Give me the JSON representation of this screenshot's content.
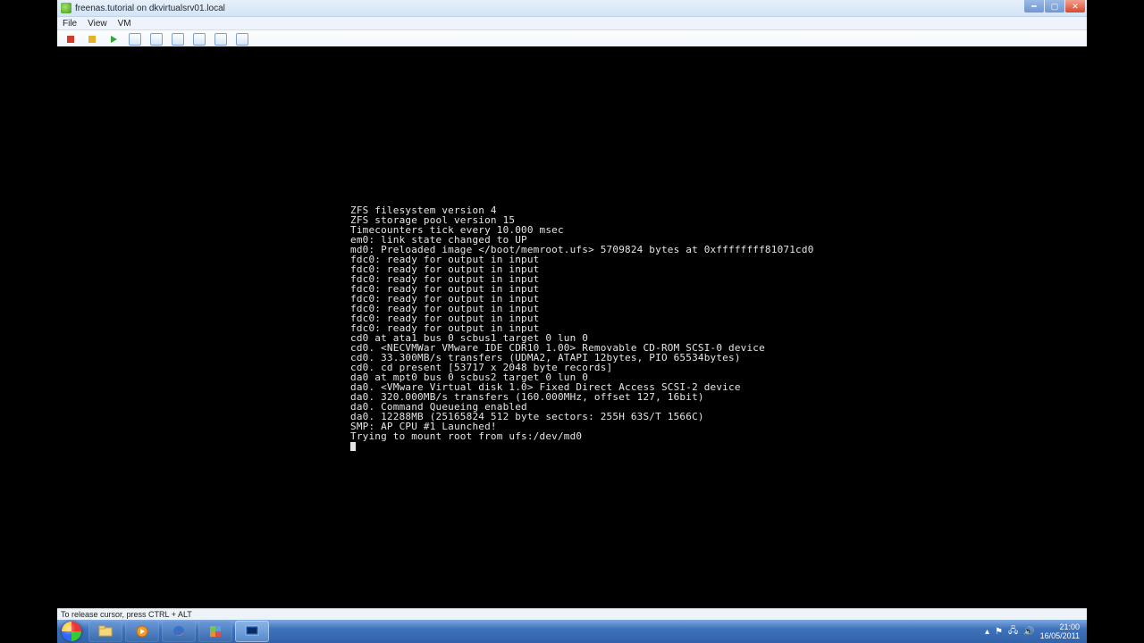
{
  "window": {
    "title": "freenas.tutorial on dkvirtualsrv01.local"
  },
  "menus": {
    "file": "File",
    "view": "View",
    "vm": "VM"
  },
  "toolbar_icons": {
    "stop": "stop-icon",
    "pause": "pause-icon",
    "play": "play-icon",
    "restart": "restart-icon",
    "snapshot": "snapshot-icon",
    "cd": "cd-icon",
    "floppy": "floppy-icon",
    "net": "net-icon",
    "fullscreen": "fullscreen-icon"
  },
  "console_lines": [
    "ZFS filesystem version 4",
    "ZFS storage pool version 15",
    "Timecounters tick every 10.000 msec",
    "em0: link state changed to UP",
    "md0: Preloaded image </boot/memroot.ufs> 5709824 bytes at 0xffffffff81071cd0",
    "fdc0: ready for output in input",
    "fdc0: ready for output in input",
    "fdc0: ready for output in input",
    "fdc0: ready for output in input",
    "fdc0: ready for output in input",
    "fdc0: ready for output in input",
    "fdc0: ready for output in input",
    "fdc0: ready for output in input",
    "cd0 at ata1 bus 0 scbus1 target 0 lun 0",
    "cd0. <NECVMWar VMware IDE CDR10 1.00> Removable CD-ROM SCSI-0 device",
    "cd0. 33.300MB/s transfers (UDMA2, ATAPI 12bytes, PIO 65534bytes)",
    "cd0. cd present [53717 x 2048 byte records]",
    "da0 at mpt0 bus 0 scbus2 target 0 lun 0",
    "da0. <VMware Virtual disk 1.0> Fixed Direct Access SCSI-2 device",
    "da0. 320.000MB/s transfers (160.000MHz, offset 127, 16bit)",
    "da0. Command Queueing enabled",
    "da0. 12288MB (25165824 512 byte sectors: 255H 63S/T 1566C)",
    "SMP: AP CPU #1 Launched!",
    "Trying to mount root from ufs:/dev/md0"
  ],
  "status": {
    "text": "To release cursor, press CTRL + ALT"
  },
  "taskbar": {
    "items": [
      {
        "name": "explorer-icon"
      },
      {
        "name": "wmp-icon"
      },
      {
        "name": "firefox-icon"
      },
      {
        "name": "vmware-icon"
      },
      {
        "name": "console-icon"
      }
    ]
  },
  "tray": {
    "time": "21:00",
    "date": "16/05/2011"
  }
}
